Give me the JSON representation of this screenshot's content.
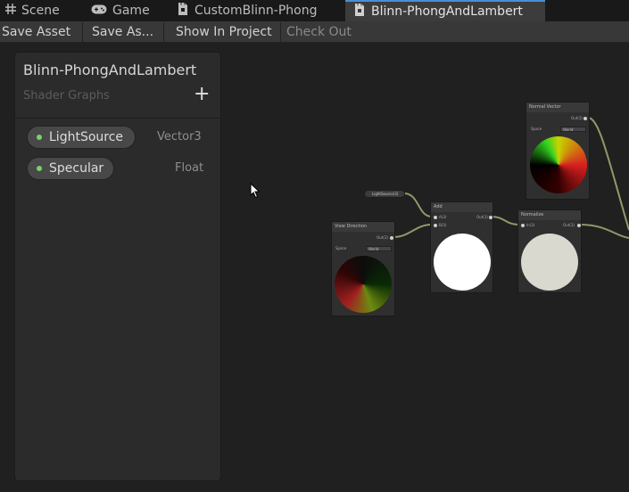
{
  "tabs": [
    {
      "label": "Scene",
      "icon": "grid-icon"
    },
    {
      "label": "Game",
      "icon": "gamepad-icon"
    },
    {
      "label": "CustomBlinn-Phong",
      "icon": "shader-graph-icon"
    },
    {
      "label": "Blinn-PhongAndLambert",
      "icon": "shader-graph-icon",
      "active": true
    }
  ],
  "toolbar": {
    "save_asset": "Save Asset",
    "save_as": "Save As...",
    "show_in_project": "Show In Project",
    "check_out": "Check Out"
  },
  "blackboard": {
    "title": "Blinn-PhongAndLambert",
    "subtitle": "Shader Graphs",
    "add_label": "+",
    "properties": [
      {
        "name": "LightSource",
        "type": "Vector3"
      },
      {
        "name": "Specular",
        "type": "Float"
      }
    ]
  },
  "nodes": {
    "normal_vector": {
      "title": "Normal Vector",
      "output": "Out(3)",
      "space_label": "Space",
      "space_value": "World"
    },
    "view_direction": {
      "title": "View Direction",
      "output": "Out(3)",
      "space_label": "Space",
      "space_value": "World"
    },
    "add": {
      "title": "Add",
      "input_a": "A(3)",
      "input_b": "B(3)",
      "output": "Out(3)"
    },
    "normalize": {
      "title": "Normalize",
      "input": "In(3)",
      "output": "Out(3)"
    },
    "light_source": {
      "label": "LightSource(3)"
    }
  },
  "colors": {
    "accent": "#4a8ed8",
    "property_dot": "#7ad26a",
    "wire": "#8d9a6a"
  }
}
